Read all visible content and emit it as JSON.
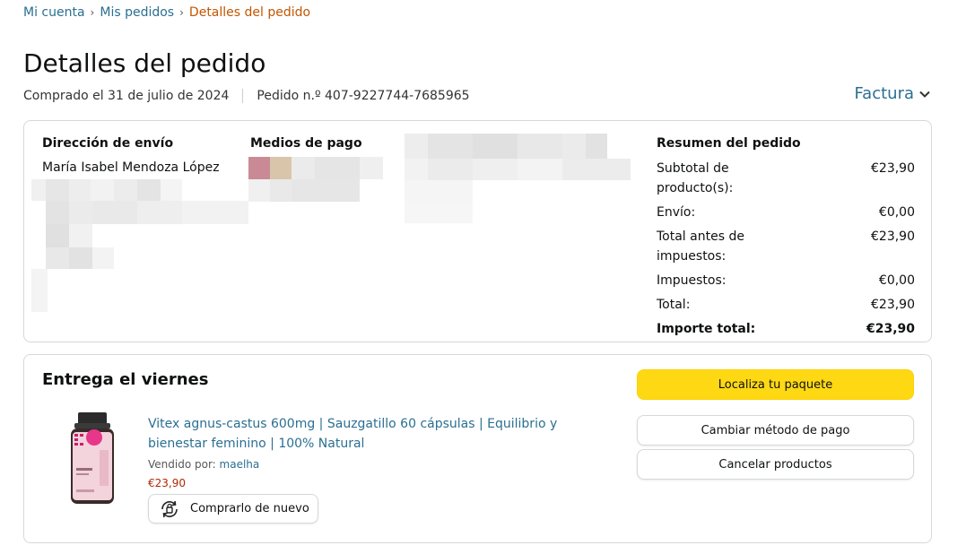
{
  "breadcrumb": {
    "items": [
      "Mi cuenta",
      "Mis pedidos",
      "Detalles del pedido"
    ],
    "separator": "›"
  },
  "page": {
    "title": "Detalles del pedido",
    "purchase_date": "Comprado el 31 de julio de 2024",
    "order_number": "Pedido n.º 407-9227744-7685965",
    "invoice_label": "Factura"
  },
  "shipping": {
    "heading": "Dirección de envío",
    "name": "María Isabel Mendoza López"
  },
  "payment": {
    "heading": "Medios de pago"
  },
  "summary": {
    "heading": "Resumen del pedido",
    "rows": [
      {
        "label": "Subtotal de producto(s):",
        "value": "€23,90"
      },
      {
        "label": "Envío:",
        "value": "€0,00"
      },
      {
        "label": "Total antes de impuestos:",
        "value": "€23,90"
      },
      {
        "label": "Impuestos:",
        "value": "€0,00"
      },
      {
        "label": "Total:",
        "value": "€23,90"
      },
      {
        "label": "Importe total:",
        "value": "€23,90"
      }
    ]
  },
  "delivery": {
    "title": "Entrega el viernes",
    "product": {
      "name": "Vitex agnus-castus 600mg | Sauzgatillo 60 cápsulas | Equilibrio y bienestar feminino | 100% Natural",
      "seller_prefix": "Vendido por:",
      "seller": "maelha",
      "price": "€23,90",
      "buy_again_label": "Comprarlo de nuevo"
    },
    "buttons": {
      "track": "Localiza tu paquete",
      "change_payment": "Cambiar método de pago",
      "cancel": "Cancelar productos"
    }
  },
  "colors": {
    "link": "#2a6f91",
    "current_crumb": "#c45500",
    "price": "#b12704",
    "primary_button": "#ffd814",
    "border": "#d5d9d9"
  }
}
